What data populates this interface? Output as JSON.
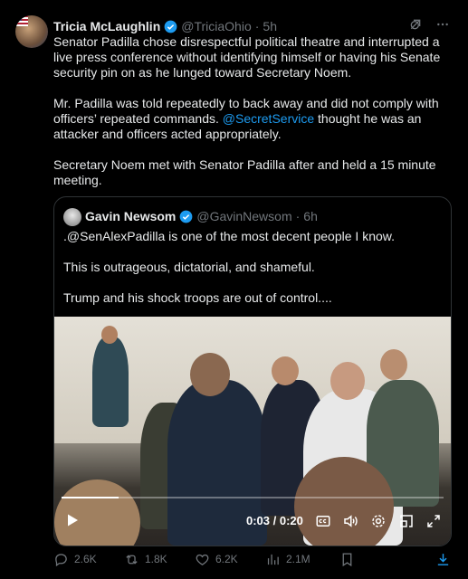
{
  "tweet": {
    "author_name": "Tricia McLaughlin",
    "handle": "@TriciaOhio",
    "time": "5h",
    "dot": "·",
    "paragraphs": {
      "p1": "Senator Padilla chose disrespectful political theatre and interrupted a live press conference without identifying himself or having his Senate security pin on as he lunged toward Secretary Noem.",
      "p2_before": "Mr. Padilla was told repeatedly to back away and did not comply with officers’ repeated commands. ",
      "p2_link": "@SecretService",
      "p2_after": " thought he was an attacker and officers acted appropriately.",
      "p3": "Secretary Noem met with Senator Padilla after and held a 15 minute meeting."
    }
  },
  "quote": {
    "author_name": "Gavin Newsom",
    "handle": "@GavinNewsom",
    "time": "6h",
    "dot": "·",
    "lines": [
      ".@SenAlexPadilla is one of the most decent people I know.",
      "This is outrageous, dictatorial, and shameful.",
      "Trump and his shock troops are out of control...."
    ]
  },
  "video": {
    "time_display": "0:03 / 0:20",
    "progress": 0.15
  },
  "actions": {
    "replies": "2.6K",
    "reposts": "1.8K",
    "likes": "6.2K",
    "views": "2.1M"
  },
  "colors": {
    "accent": "#1d9bf0",
    "muted": "#71767b",
    "text": "#e7e9ea",
    "border": "#2f3336"
  },
  "icons": [
    "verified-badge-icon",
    "grok-icon",
    "more-icon",
    "play-icon",
    "captions-icon",
    "volume-icon",
    "settings-icon",
    "pip-icon",
    "fullscreen-icon",
    "reply-icon",
    "repost-icon",
    "like-icon",
    "views-icon",
    "bookmark-icon",
    "download-icon"
  ]
}
